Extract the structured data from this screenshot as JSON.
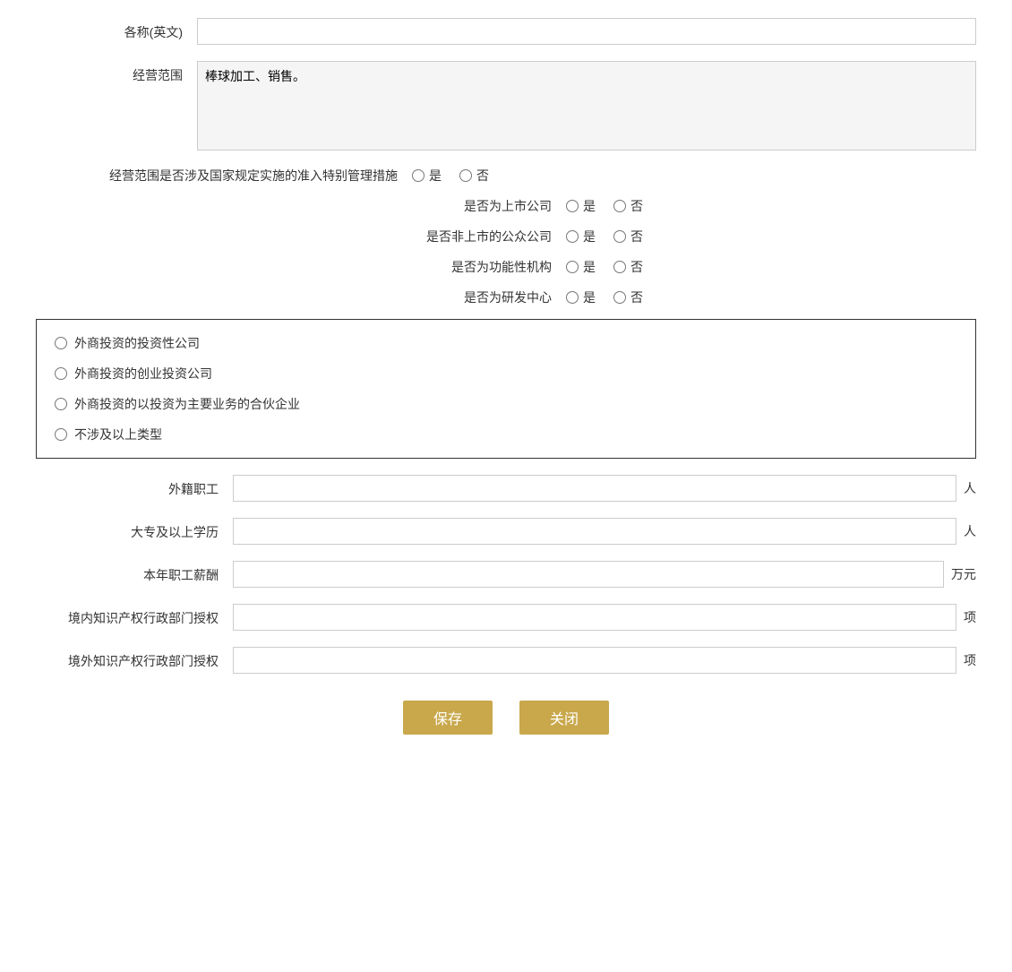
{
  "fields": {
    "name_en_label": "各称(英文)",
    "business_scope_label": "经营范围",
    "business_scope_value": "棒球加工、销售。",
    "special_management_label": "经营范围是否涉及国家规定实施的准入特别管理措施",
    "listed_company_label": "是否为上市公司",
    "non_listed_public_label": "是否非上市的公众公司",
    "functional_institution_label": "是否为功能性机构",
    "rd_center_label": "是否为研发中心",
    "yes_label": "是",
    "no_label": "否",
    "investment_options": [
      "外商投资的投资性公司",
      "外商投资的创业投资公司",
      "外商投资的以投资为主要业务的合伙企业",
      "不涉及以上类型"
    ],
    "foreign_staff_label": "外籍职工",
    "foreign_staff_unit": "人",
    "college_edu_label": "大专及以上学历",
    "college_edu_unit": "人",
    "annual_salary_label": "本年职工薪酬",
    "annual_salary_unit": "万元",
    "domestic_ip_label": "境内知识产权行政部门授权",
    "domestic_ip_unit": "项",
    "foreign_ip_label": "境外知识产权行政部门授权",
    "foreign_ip_unit": "项",
    "save_button": "保存",
    "close_button": "关闭"
  }
}
